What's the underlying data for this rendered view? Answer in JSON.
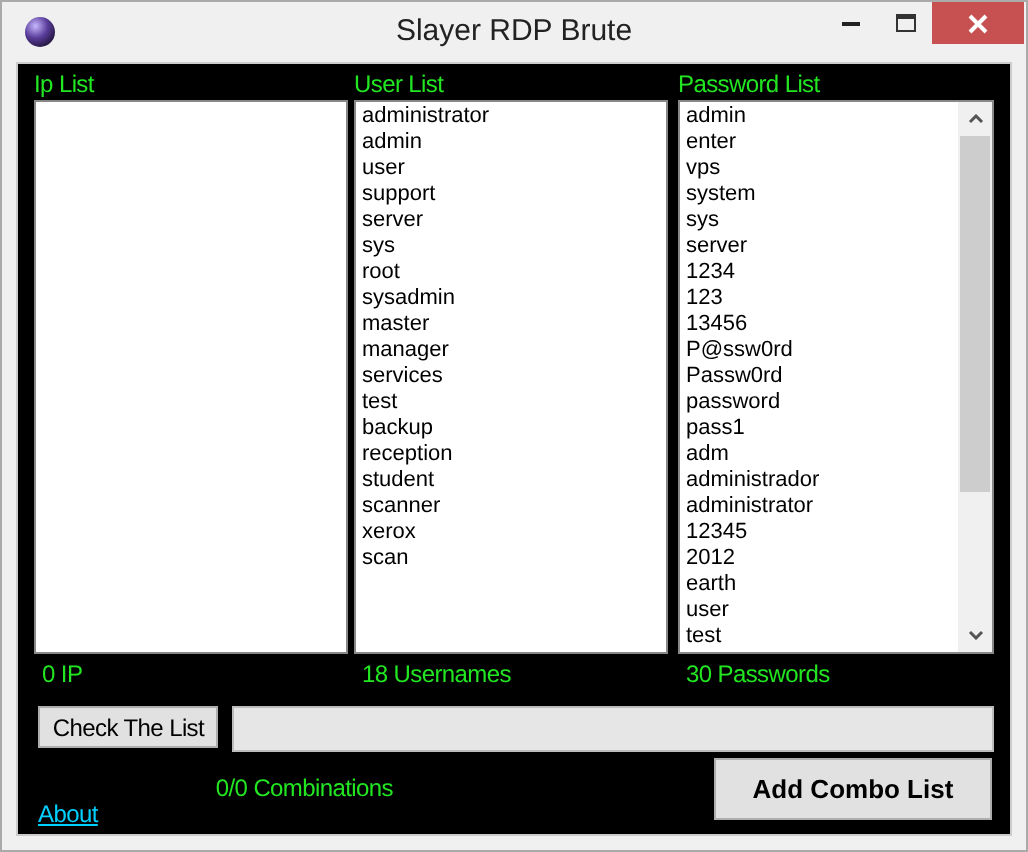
{
  "window": {
    "title": "Slayer RDP Brute"
  },
  "lists": [
    {
      "label": "Ip List",
      "count": "0 IP",
      "scrollbar": false
    },
    {
      "label": "User List",
      "items": [
        "administrator",
        "admin",
        "user",
        "support",
        "server",
        "sys",
        "root",
        "sysadmin",
        "master",
        "manager",
        "services",
        "test",
        "backup",
        "reception",
        "student",
        "scanner",
        "xerox",
        "scan"
      ],
      "count": "18 Usernames",
      "scrollbar": false
    },
    {
      "label": "Password List",
      "items": [
        "admin",
        "enter",
        "vps",
        "system",
        "sys",
        "server",
        "1234",
        "123",
        "13456",
        "P@ssw0rd",
        "Passw0rd",
        "password",
        "pass1",
        "adm",
        "administrador",
        "administrator",
        "12345",
        "2012",
        "earth",
        "user",
        "test"
      ],
      "count": "30 Passwords",
      "scrollbar": true
    }
  ],
  "check_button": "Check The List",
  "progress": {
    "level": 0
  },
  "combinations": "0/0 Combinations",
  "add_button": "Add Combo List",
  "about_link": "About"
}
